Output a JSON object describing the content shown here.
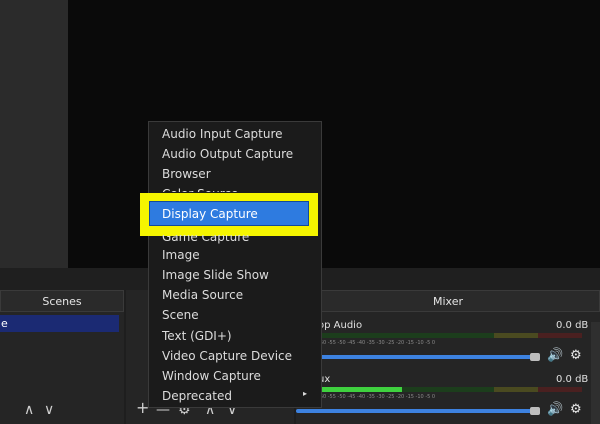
{
  "docks": {
    "scenes_title": "Scenes",
    "mixer_title": "Mixer",
    "scene_item": "e"
  },
  "menu": {
    "items": [
      "Audio Input Capture",
      "Audio Output Capture",
      "Browser",
      "Color Source",
      "Display Capture",
      "Game Capture",
      "Image",
      "Image Slide Show",
      "Media Source",
      "Scene",
      "Text (GDI+)",
      "Video Capture Device",
      "Window Capture",
      "Deprecated"
    ],
    "highlighted": "Display Capture",
    "deprecated_arrow": "▸"
  },
  "mixer": {
    "channels": [
      {
        "name": "op Audio",
        "db": "0.0 dB",
        "level": 0.0
      },
      {
        "name": "ux",
        "db": "0.0 dB",
        "level": 0.32
      }
    ],
    "tick_labels": "-60 -55 -50 -45 -40 -35 -30 -25 -20 -15 -10 -5 0"
  },
  "toolbar": {
    "scenes_up": "∧",
    "scenes_down": "∨",
    "add": "+",
    "remove": "—",
    "gear": "⚙",
    "up": "∧",
    "down": "∨"
  },
  "icons": {
    "volume": "🔊",
    "gear": "⚙"
  },
  "colors": {
    "highlight_outline": "#f5f500",
    "selected_item": "#2e7be0",
    "scene_selected": "#1b2a73",
    "volume_slider": "#3d82e0",
    "meter_green": "#3fd13f"
  }
}
